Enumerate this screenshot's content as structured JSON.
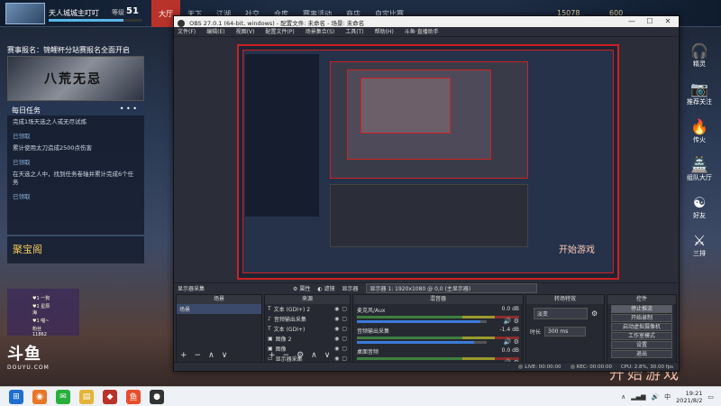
{
  "game": {
    "player_name": "天人城城主叮叮",
    "level_label": "等级",
    "level_value": "51",
    "exp_fraction": 0.8,
    "nav": [
      "大厅",
      "天下",
      "江湖",
      "社交",
      "仓库",
      "赛事活动",
      "商店",
      "自定比赛"
    ],
    "active_nav": "大厅",
    "currency_1": "15078",
    "currency_2": "600",
    "event_title": "赛事报名：锦鲤杯分站赛报名全面开启",
    "event_banner_text": "八荒无忌",
    "tasks_title": "每日任务",
    "tasks_more": "• • •",
    "tasks": [
      {
        "text": "完成1场天选之人或无尽试炼",
        "status": "已领取"
      },
      {
        "text": "累计使用太刀造成2500点伤害",
        "status": "已领取"
      },
      {
        "text": "在天选之人中，找到任务卷轴并累计完成6个任务",
        "status": "已领取"
      }
    ],
    "treasure_label": "聚宝阁",
    "anchor_lines": [
      "♥1 一狗",
      "♥1 星辰海",
      "♥1 喵~",
      "粉丝 11862"
    ],
    "douyu_logo": "斗鱼",
    "douyu_sub": "DOUYU.COM",
    "right_items": [
      {
        "icon": "headset-icon",
        "glyph": "🎧",
        "label": "精灵"
      },
      {
        "icon": "camera-icon",
        "glyph": "📷",
        "label": "推荐关注"
      },
      {
        "icon": "flame-icon",
        "glyph": "🔥",
        "label": "传火"
      },
      {
        "icon": "banner-icon",
        "glyph": "🏯",
        "label": "组队大厅"
      },
      {
        "icon": "friend-icon",
        "glyph": "☯",
        "label": "好友"
      },
      {
        "icon": "swords-icon",
        "glyph": "⚔",
        "label": "三排"
      }
    ],
    "promo_text": "开始游戏"
  },
  "obs": {
    "title": "OBS 27.0.1 (64-bit, windows) - 配置文件: 未命名 - 场景: 未命名",
    "menu": [
      "文件(F)",
      "编辑(E)",
      "视图(V)",
      "配置文件(P)",
      "场景集合(S)",
      "工具(T)",
      "帮助(H)",
      "斗鱼·直播助手"
    ],
    "source_type_label": "显示器采集",
    "properties_label": "属性",
    "filters_label": "滤镜",
    "display_label": "显示器",
    "display_value": "显示器 1: 1920x1080 @ 0,0 (主显示器)",
    "docks": {
      "scenes_title": "场景",
      "sources_title": "来源",
      "mixer_title": "混音器",
      "transitions_title": "转场特效",
      "controls_title": "控件"
    },
    "scenes": [
      "场景"
    ],
    "sources": [
      {
        "name": "文本 (GDI+) 2",
        "icon": "text-icon"
      },
      {
        "name": "音频输出采集",
        "icon": "speaker-icon"
      },
      {
        "name": "文本 (GDI+)",
        "icon": "text-icon"
      },
      {
        "name": "图像 2",
        "icon": "image-icon"
      },
      {
        "name": "图像",
        "icon": "image-icon"
      },
      {
        "name": "显示器采集",
        "icon": "monitor-icon"
      }
    ],
    "mixer": [
      {
        "name": "麦克风/Aux",
        "db": "0.0 dB",
        "level": 0.95
      },
      {
        "name": "音频输出采集",
        "db": "-1.4 dB",
        "level": 0.9
      },
      {
        "name": "桌面音频",
        "db": "0.0 dB",
        "level": 0.95
      }
    ],
    "transition_value": "淡变",
    "duration_label": "时长",
    "duration_value": "300 ms",
    "controls": [
      "停止推流",
      "开始录制",
      "启动虚拟摄像机",
      "工作室模式",
      "设置",
      "退出"
    ],
    "status": {
      "live": "LIVE: 00:00:00",
      "rec": "REC: 00:00:00",
      "cpu": "CPU: 2.8%, 30.00 fps"
    },
    "preview_promo": "开始游戏"
  },
  "taskbar": {
    "time": "19:21",
    "date": "2021/8/2",
    "apps": [
      {
        "icon": "windows-start-icon",
        "color": "#1f6fd0",
        "glyph": "⊞"
      },
      {
        "icon": "firefox-icon",
        "color": "#e8772a",
        "glyph": "◉"
      },
      {
        "icon": "wechat-icon",
        "color": "#2aae3c",
        "glyph": "✉"
      },
      {
        "icon": "file-explorer-icon",
        "color": "#e3b33a",
        "glyph": "▤"
      },
      {
        "icon": "game-launcher-icon",
        "color": "#b8332a",
        "glyph": "◆"
      },
      {
        "icon": "douyu-icon",
        "color": "#e84c2a",
        "glyph": "鱼"
      },
      {
        "icon": "obs-icon",
        "color": "#333333",
        "glyph": "●"
      }
    ]
  }
}
